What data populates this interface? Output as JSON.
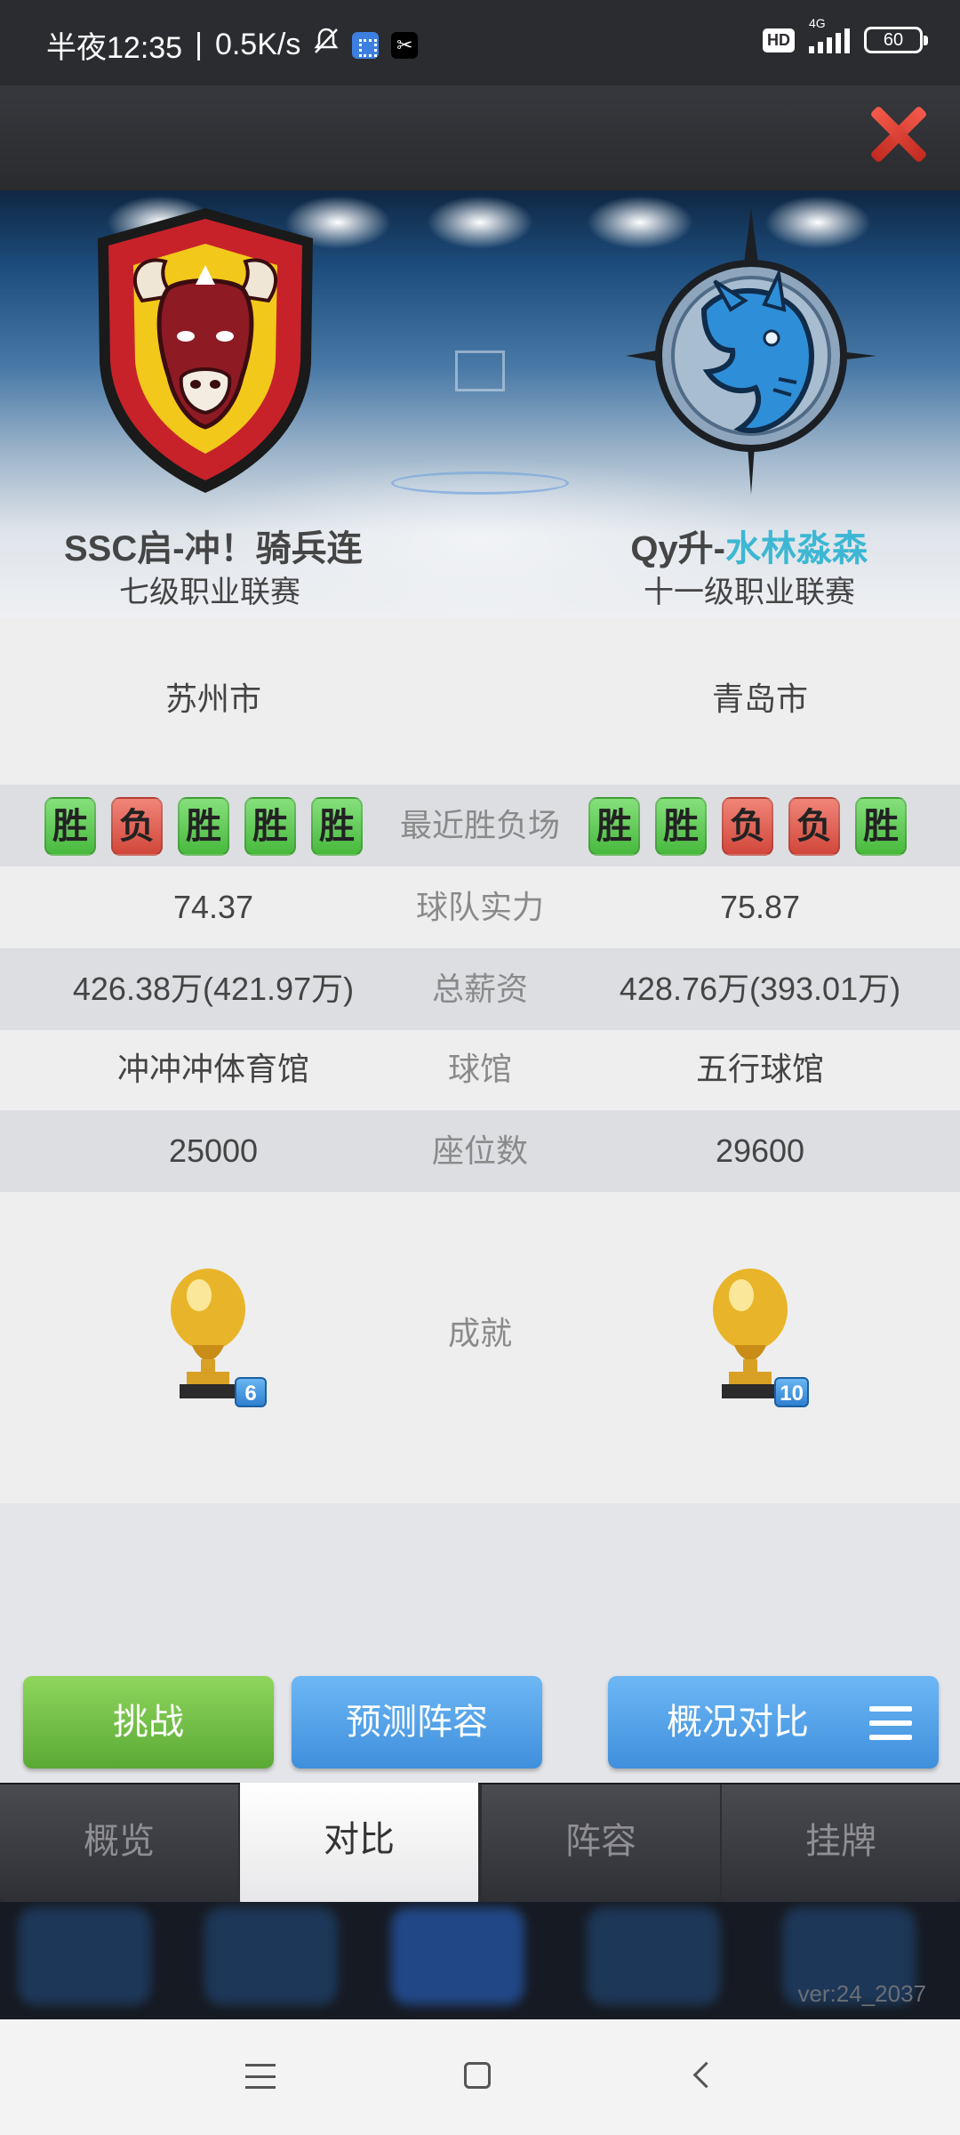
{
  "status_bar": {
    "time": "半夜12:35",
    "separator": "|",
    "net_speed": "0.5K/s",
    "network": "4G",
    "hd": "HD",
    "battery": "60"
  },
  "teams": {
    "left": {
      "name": "SSC启-冲！骑兵连",
      "league": "七级职业联赛",
      "city": "苏州市",
      "recent": [
        "胜",
        "负",
        "胜",
        "胜",
        "胜"
      ],
      "strength": "74.37",
      "salary": "426.38万(421.97万)",
      "arena": "冲冲冲体育馆",
      "seats": "25000",
      "trophies": "6"
    },
    "right": {
      "name_prefix": "Qy升-",
      "name_highlight": "水林淼森",
      "league": "十一级职业联赛",
      "city": "青岛市",
      "recent": [
        "胜",
        "胜",
        "负",
        "负",
        "胜"
      ],
      "strength": "75.87",
      "salary": "428.76万(393.01万)",
      "arena": "五行球馆",
      "seats": "29600",
      "trophies": "10"
    }
  },
  "labels": {
    "recent": "最近胜负场",
    "strength": "球队实力",
    "salary": "总薪资",
    "arena": "球馆",
    "seats": "座位数",
    "achievements": "成就"
  },
  "buttons": {
    "challenge": "挑战",
    "predict": "预测阵容",
    "overview": "概况对比"
  },
  "tabs": [
    "概览",
    "对比",
    "阵容",
    "挂牌"
  ],
  "active_tab": "对比",
  "version": "ver:24_2037",
  "colors": {
    "win": "#5cc14f",
    "lose": "#dd5a4c",
    "accent_blue": "#4a9be6",
    "accent_green": "#6fbd45",
    "highlight_cyan": "#3db7d3"
  }
}
